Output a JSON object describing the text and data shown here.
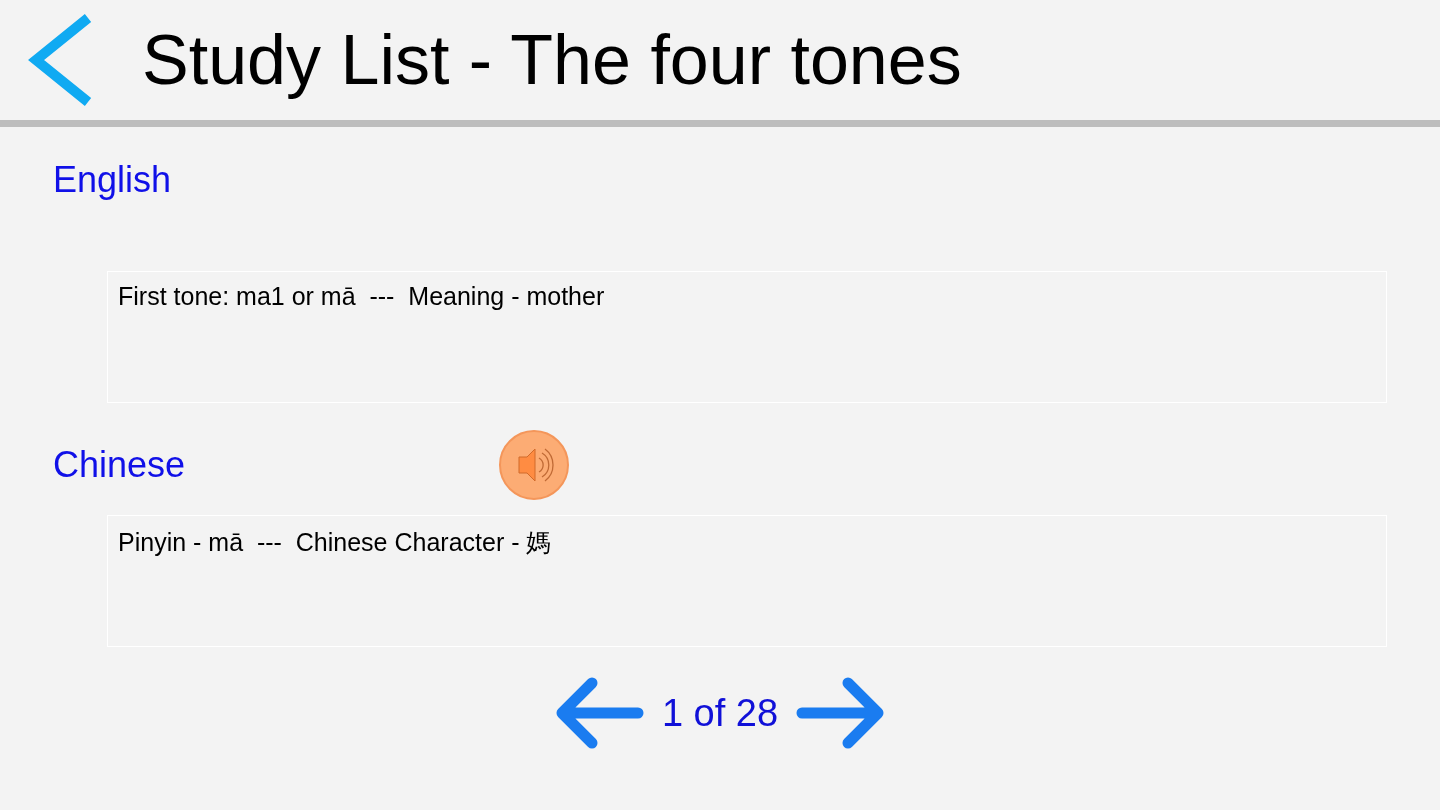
{
  "header": {
    "title": "Study List - The four tones"
  },
  "sections": [
    {
      "label": "English",
      "has_audio": false,
      "text": "First tone: ma1 or mā  ---  Meaning - mother"
    },
    {
      "label": "Chinese",
      "has_audio": true,
      "text": "Pinyin - mā  ---  Chinese Character - 媽"
    }
  ],
  "pager": {
    "text": "1 of 28"
  }
}
